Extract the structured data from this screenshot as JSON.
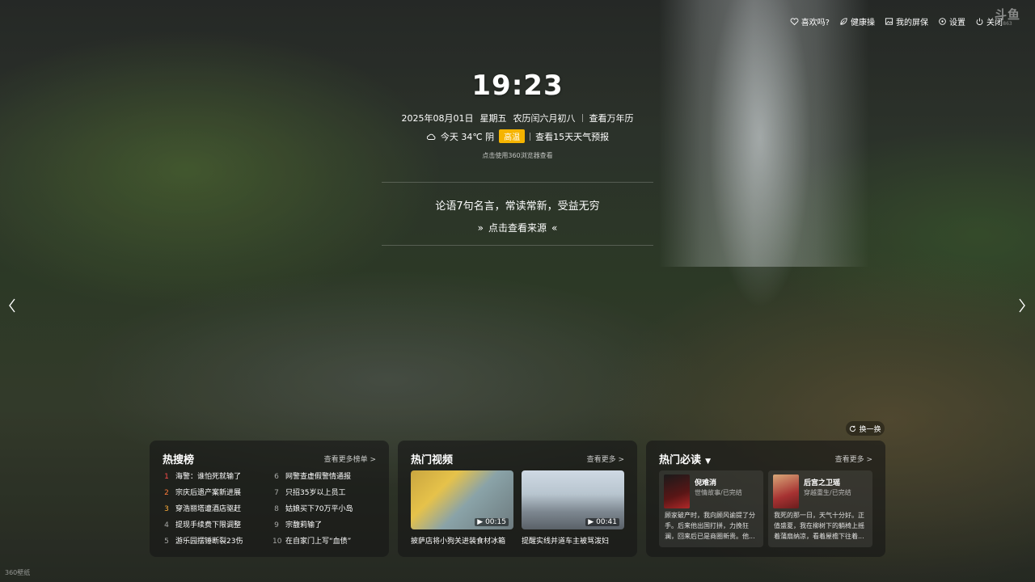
{
  "topbar": {
    "like": "喜欢吗?",
    "health": "健康操",
    "screensaver": "我的屏保",
    "settings": "设置",
    "close": "关闭",
    "brand_logo": "斗鱼",
    "brand_sub": "863"
  },
  "clock": {
    "time": "19:23",
    "date": "2025年08月01日",
    "weekday": "星期五",
    "lunar": "农历闰六月初八",
    "calendar_link": "查看万年历"
  },
  "weather": {
    "summary": "今天 34℃ 阴",
    "warning": "高温",
    "forecast_link": "查看15天天气预报",
    "warning_color": "#f5b400"
  },
  "hint": "点击使用360浏览器查看",
  "quote": {
    "text": "论语7句名言，常读常新，受益无穷",
    "source_link": "点击查看来源"
  },
  "refresh": "换一换",
  "hot_search": {
    "title": "热搜榜",
    "more": "查看更多榜单 >",
    "items": [
      {
        "rank": "1",
        "text": "海警：谁怕死就输了"
      },
      {
        "rank": "6",
        "text": "网警查虚假警情通报"
      },
      {
        "rank": "2",
        "text": "宗庆后遗产案新进展"
      },
      {
        "rank": "7",
        "text": "只招35岁以上员工"
      },
      {
        "rank": "3",
        "text": "穿浩丽塔遭酒店驱赶"
      },
      {
        "rank": "8",
        "text": "姑娘买下70万平小岛"
      },
      {
        "rank": "4",
        "text": "提现手续费下限调整"
      },
      {
        "rank": "9",
        "text": "宗馥莉输了"
      },
      {
        "rank": "5",
        "text": "游乐园摆锤断裂23伤"
      },
      {
        "rank": "10",
        "text": "在自家门上写“血债”"
      }
    ]
  },
  "hot_video": {
    "title": "热门视频",
    "more": "查看更多 >",
    "items": [
      {
        "duration": "00:15",
        "caption": "披萨店将小狗关进装食材冰箱"
      },
      {
        "duration": "00:41",
        "caption": "提醒实线并道车主被骂泼妇"
      }
    ]
  },
  "hot_read": {
    "title": "热门必读",
    "more": "查看更多 >",
    "items": [
      {
        "title": "倪难消",
        "tag": "世情故事/已完结",
        "desc": "顾家破产时，我向顾风谕提了分手。后来他出国打拼，力挽狂澜，回来后已是商圈新贵。他..."
      },
      {
        "title": "后宫之卫瑶",
        "tag": "穿越重生/已完结",
        "desc": "我死的那一日，天气十分好。正值盛夏，我在柳树下的躺椅上摇着蒲扇纳凉，看着屋檐下往着..."
      }
    ]
  },
  "watermark": "360壁纸"
}
